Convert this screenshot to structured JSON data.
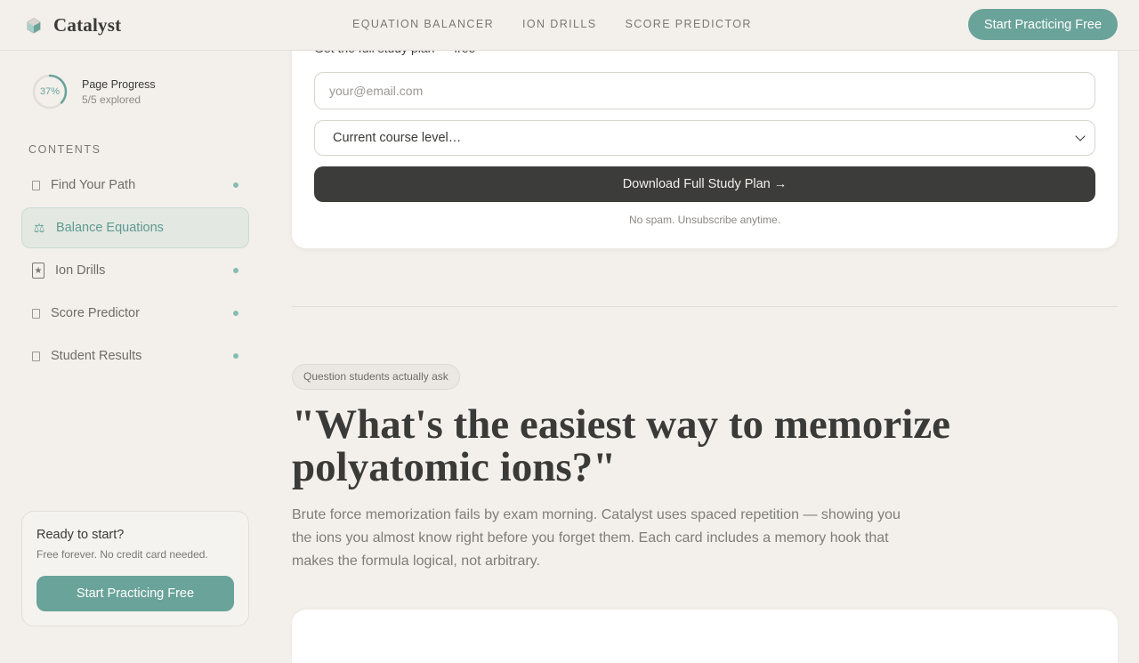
{
  "header": {
    "brand": "Catalyst",
    "logo_icon": "flask-cube-icon",
    "nav": [
      "EQUATION BALANCER",
      "ION DRILLS",
      "SCORE PREDICTOR"
    ],
    "cta": "Start Practicing Free"
  },
  "sidebar": {
    "progress": {
      "percent_label": "37%",
      "percent_value": 0.37,
      "title": "Page Progress",
      "sub": "5/5 explored"
    },
    "contents_label": "CONTENTS",
    "items": [
      {
        "label": "Find Your Path",
        "icon": "checkbox-icon",
        "active": false,
        "dot": true
      },
      {
        "label": "Balance Equations",
        "icon": "scale-icon",
        "active": true,
        "dot": false
      },
      {
        "label": "Ion Drills",
        "icon": "star-card-icon",
        "active": false,
        "dot": true
      },
      {
        "label": "Score Predictor",
        "icon": "checkbox-icon",
        "active": false,
        "dot": true
      },
      {
        "label": "Student Results",
        "icon": "checkbox-icon",
        "active": false,
        "dot": true
      }
    ],
    "ready": {
      "title": "Ready to start?",
      "sub": "Free forever. No credit card needed.",
      "button": "Start Practicing Free"
    }
  },
  "form": {
    "heading": "Get the full study plan — free",
    "email_placeholder": "your@email.com",
    "level_selected": "Current course level…",
    "download": "Download Full Study Plan →",
    "nospam": "No spam. Unsubscribe anytime."
  },
  "question": {
    "badge": "Question students actually ask",
    "title": "\"What's the easiest way to memorize polyatomic ions?\"",
    "description": "Brute force memorization fails by exam morning. Catalyst uses spaced repetition — showing you the ions you almost know right before you forget them. Each card includes a memory hook that makes the formula logical, not arbitrary."
  },
  "colors": {
    "accent": "#6aa39a",
    "background": "#f3f0eb",
    "dark_button": "#3c3c3a"
  }
}
